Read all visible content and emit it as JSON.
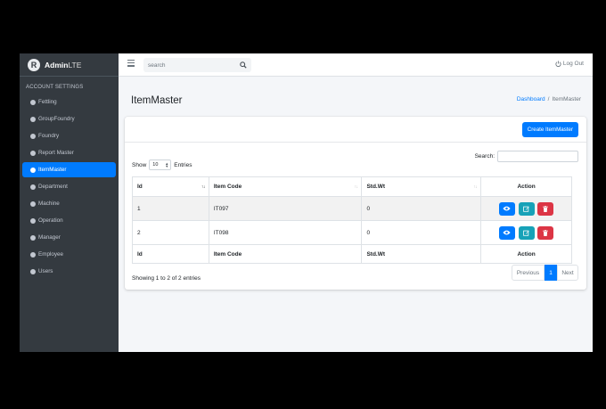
{
  "brand": {
    "bold": "Admin",
    "light": "LTE",
    "logo_letter": "R"
  },
  "sidebar": {
    "header": "ACCOUNT SETTINGS",
    "items": [
      {
        "label": "Fettling"
      },
      {
        "label": "GroupFoundry"
      },
      {
        "label": "Foundry"
      },
      {
        "label": "Report Master"
      },
      {
        "label": "ItemMaster",
        "active": true
      },
      {
        "label": "Department"
      },
      {
        "label": "Machine"
      },
      {
        "label": "Operation"
      },
      {
        "label": "Manager"
      },
      {
        "label": "Employee"
      },
      {
        "label": "Users"
      }
    ]
  },
  "topbar": {
    "search_placeholder": "search",
    "logout_label": "Log Out"
  },
  "page": {
    "title": "ItemMaster",
    "breadcrumb": {
      "home": "Dashboard",
      "separator": "/",
      "current": "ItemMaster"
    }
  },
  "card": {
    "create_label": "Create ItemMaster",
    "search_label": "Search:",
    "show_label": "Show",
    "entries_value": "10",
    "entries_label": "Entries",
    "columns": [
      "Id",
      "Item Code",
      "Std.Wt",
      "Action"
    ],
    "rows": [
      {
        "id": "1",
        "item_code": "IT097",
        "std_wt": "0"
      },
      {
        "id": "2",
        "item_code": "IT098",
        "std_wt": "0"
      }
    ],
    "info": "Showing 1 to 2 of 2 entries",
    "pagination": {
      "previous": "Previous",
      "current": "1",
      "next": "Next"
    }
  },
  "colors": {
    "primary": "#007bff",
    "info": "#17a2b8",
    "danger": "#dc3545",
    "sidebar": "#343a40"
  }
}
